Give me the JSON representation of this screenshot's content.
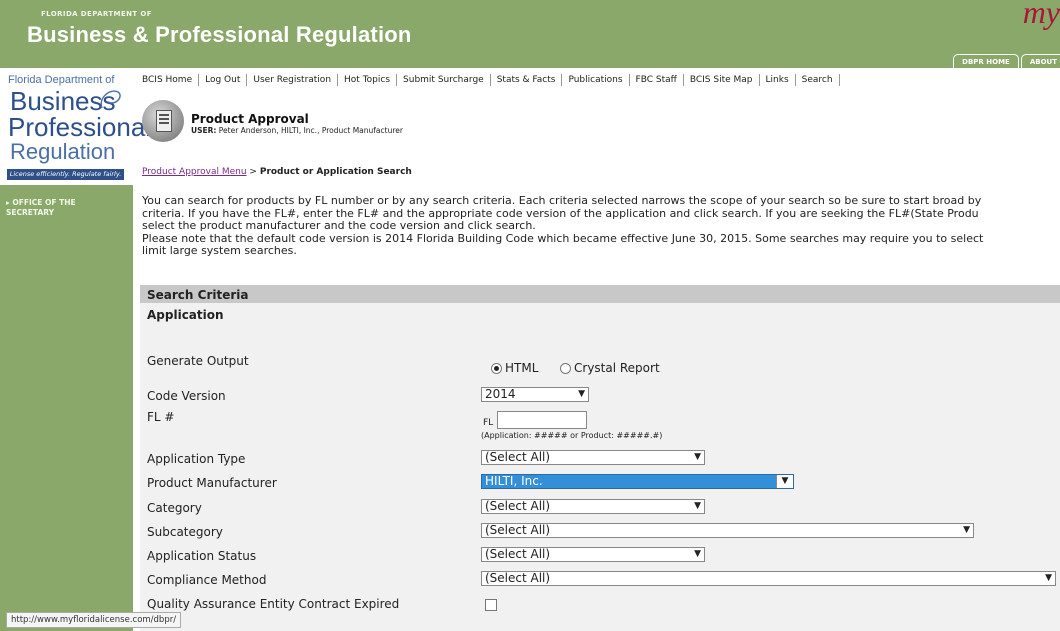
{
  "header": {
    "small_title": "FLORIDA DEPARTMENT OF",
    "big_title": "Business & Professional Regulation",
    "brand_script": "my",
    "tabs": [
      "DBPR HOME",
      "ABOUT"
    ]
  },
  "sidebar": {
    "logo_line1": "Florida Department of",
    "logo_line2": "Business",
    "logo_line3": "Professional",
    "logo_line4": "Regulation",
    "logo_tagline": "License efficiently. Regulate fairly.",
    "link": "OFFICE OF THE SECRETARY"
  },
  "nav": [
    "BCIS Home",
    "Log Out",
    "User Registration",
    "Hot Topics",
    "Submit Surcharge",
    "Stats & Facts",
    "Publications",
    "FBC Staff",
    "BCIS Site Map",
    "Links",
    "Search"
  ],
  "page": {
    "title": "Product Approval",
    "user_label": "USER:",
    "user_value": "Peter Anderson, HILTI, Inc., Product Manufacturer",
    "breadcrumb_link": "Product Approval Menu",
    "breadcrumb_sep": ">",
    "breadcrumb_current": "Product or Application Search",
    "desc_lines": [
      "You can search for products by FL number or by any search criteria. Each criteria selected narrows the scope of your search so be sure to start broad by",
      "criteria. If you have the FL#, enter the FL# and the appropriate code version of the application and click search. If you are seeking the FL#(State Produ",
      "select the product manufacturer and the code version and click search.",
      "Please note that the default code version is 2014 Florida Building Code which became effective June 30, 2015. Some searches may require you to select",
      "limit large system searches."
    ]
  },
  "form": {
    "section_title": "Search Criteria",
    "subsection": "Application",
    "generate_output_label": "Generate Output",
    "output_html": "HTML",
    "output_crystal": "Crystal Report",
    "code_version_label": "Code Version",
    "code_version_value": "2014",
    "fl_label": "FL #",
    "fl_prefix": "FL",
    "fl_hint": "(Application: ##### or Product: #####.#)",
    "application_type_label": "Application Type",
    "application_type_value": "(Select All)",
    "manufacturer_label": "Product Manufacturer",
    "manufacturer_value": "HILTI, Inc.",
    "category_label": "Category",
    "category_value": "(Select All)",
    "subcategory_label": "Subcategory",
    "subcategory_value": "(Select All)",
    "status_label": "Application Status",
    "status_value": "(Select All)",
    "compliance_label": "Compliance Method",
    "compliance_value": "(Select All)",
    "qa_label": "Quality Assurance Entity Contract Expired"
  },
  "statusbar": "http://www.myfloridalicense.com/dbpr/",
  "colors": {
    "header_green": "#8aa86a",
    "brand_red": "#a8173a",
    "select_highlight": "#3390d8"
  }
}
